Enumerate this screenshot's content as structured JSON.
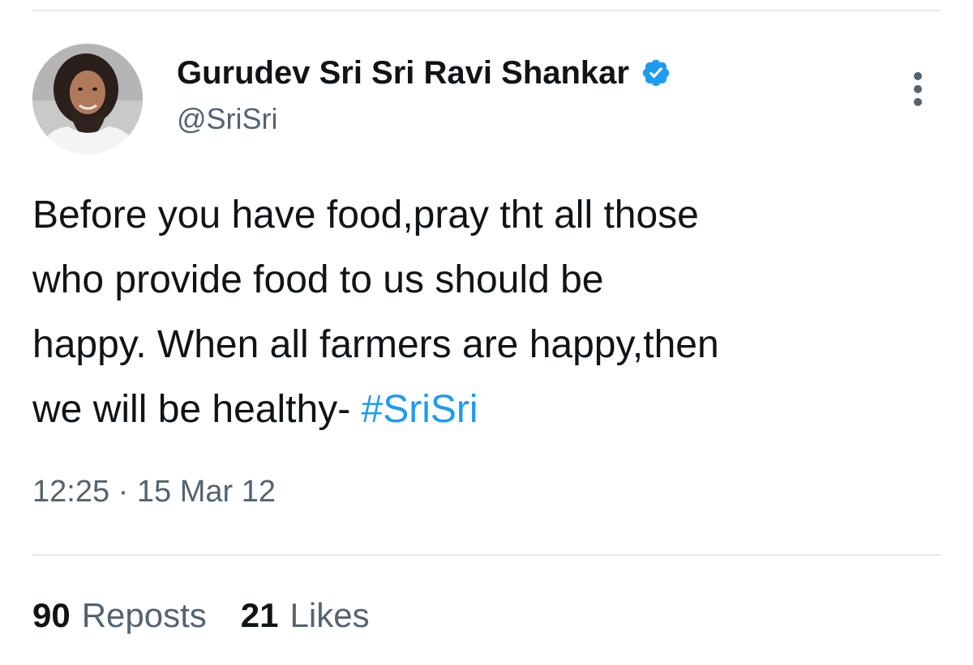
{
  "tweet": {
    "author": {
      "display_name": "Gurudev Sri Sri Ravi Shankar",
      "handle": "@SriSri",
      "verified": true,
      "avatar_icon": "profile-photo"
    },
    "text_lines": [
      "Before you have food,pray tht all those",
      "who provide food to us should be",
      "happy. When all farmers are happy,then",
      "we will be healthy- "
    ],
    "hashtag": "#SriSri",
    "time": "12:25",
    "separator": "·",
    "date": "15 Mar 12",
    "stats": {
      "reposts_count": "90",
      "reposts_label": "Reposts",
      "likes_count": "21",
      "likes_label": "Likes"
    }
  },
  "colors": {
    "text_primary": "#0f1419",
    "text_secondary": "#536471",
    "accent": "#1d9bf0",
    "divider": "#e6e9ec"
  },
  "icons": {
    "verified": "verified-badge-icon",
    "more": "more-vertical-icon"
  }
}
